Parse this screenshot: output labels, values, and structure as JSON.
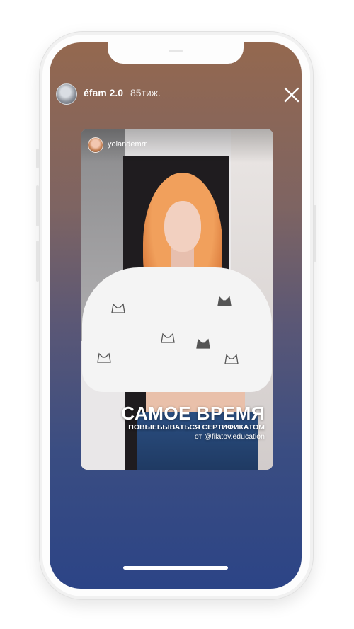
{
  "story": {
    "username": "éfam 2.0",
    "time_ago": "85тиж."
  },
  "reshared_post": {
    "username": "yolandemrr",
    "caption_title": "САМОЕ ВРЕМЯ",
    "caption_subtitle": "ПОВЫЕБЫВАТЬСЯ СЕРТИФИКАТОМ",
    "caption_from": "от @filatov.education"
  },
  "icons": {
    "close": "close-icon",
    "avatar": "avatar"
  },
  "colors": {
    "gradient_top": "#94684f",
    "gradient_bottom": "#2c4486",
    "text": "#ffffff"
  }
}
